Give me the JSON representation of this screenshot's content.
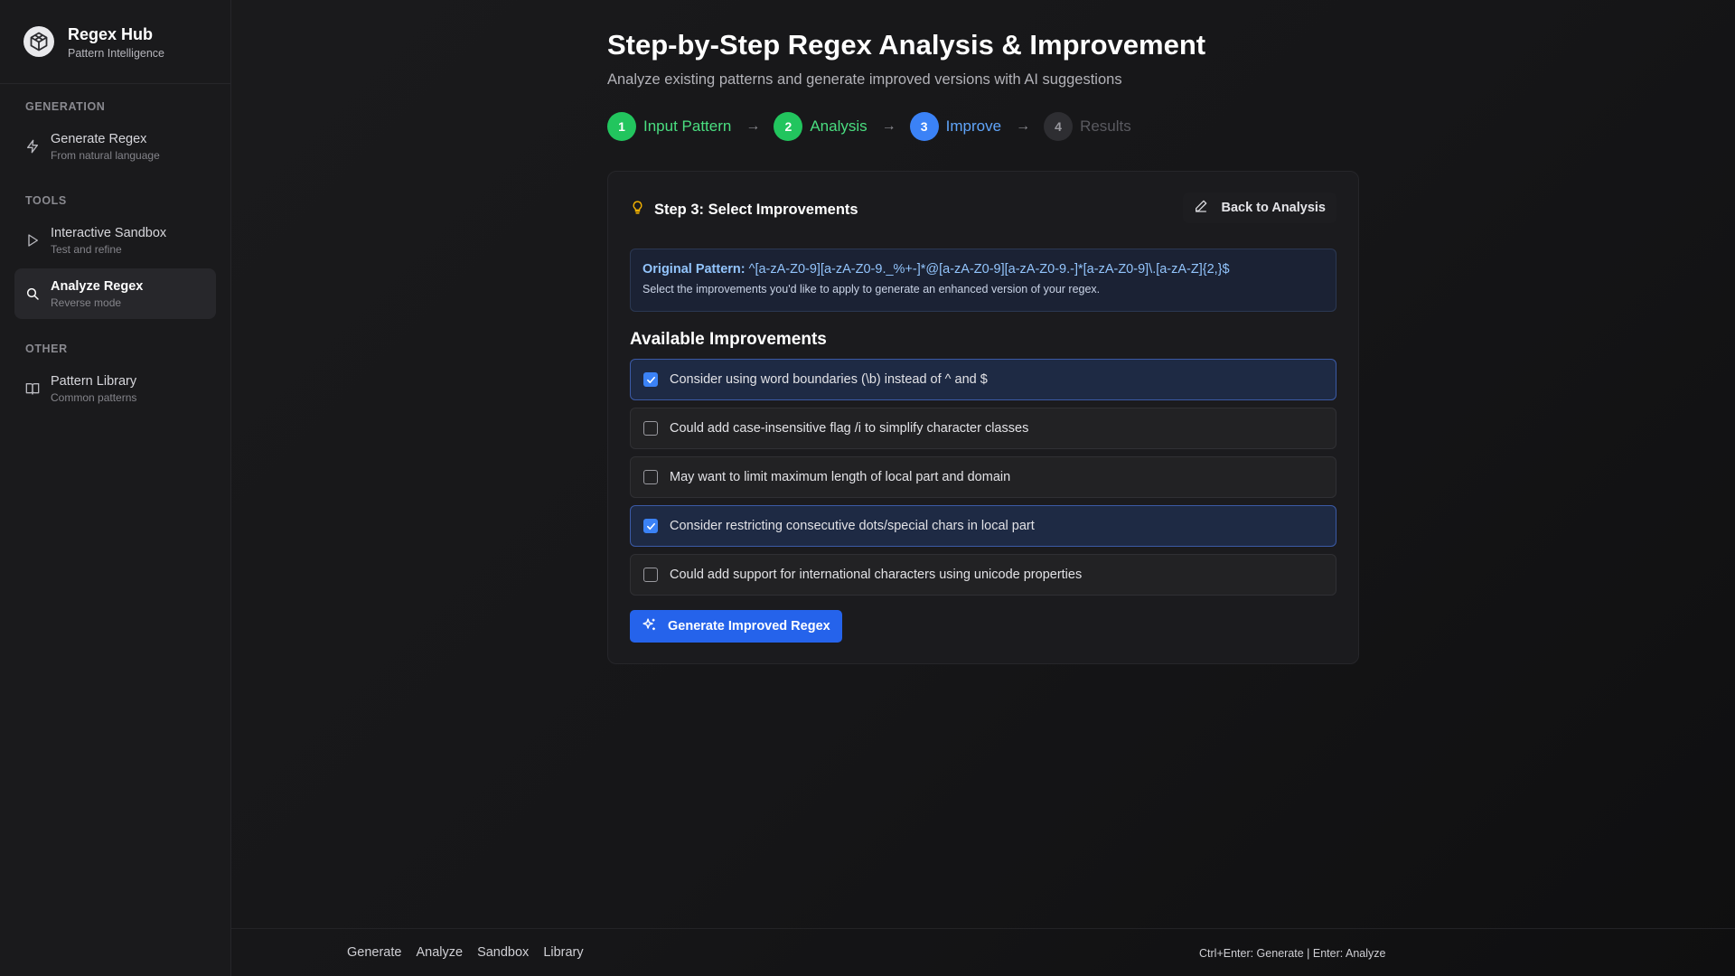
{
  "brand": {
    "title": "Regex Hub",
    "subtitle": "Pattern Intelligence"
  },
  "sidebar": {
    "sections": [
      {
        "label": "GENERATION",
        "items": [
          {
            "title": "Generate Regex",
            "subtitle": "From natural language",
            "icon": "lightning-icon",
            "active": false
          }
        ]
      },
      {
        "label": "TOOLS",
        "items": [
          {
            "title": "Interactive Sandbox",
            "subtitle": "Test and refine",
            "icon": "play-icon",
            "active": false
          },
          {
            "title": "Analyze Regex",
            "subtitle": "Reverse mode",
            "icon": "search-icon",
            "active": true
          }
        ]
      },
      {
        "label": "OTHER",
        "items": [
          {
            "title": "Pattern Library",
            "subtitle": "Common patterns",
            "icon": "book-icon",
            "active": false
          }
        ]
      }
    ]
  },
  "header": {
    "title": "Step-by-Step Regex Analysis & Improvement",
    "subtitle": "Analyze existing patterns and generate improved versions with AI suggestions"
  },
  "steps": [
    {
      "number": "1",
      "label": "Input Pattern",
      "state": "done"
    },
    {
      "number": "2",
      "label": "Analysis",
      "state": "done"
    },
    {
      "number": "3",
      "label": "Improve",
      "state": "current"
    },
    {
      "number": "4",
      "label": "Results",
      "state": "pending"
    }
  ],
  "card": {
    "title": "Step 3: Select Improvements",
    "back_label": "Back to Analysis",
    "pattern_label": "Original Pattern:",
    "pattern_value": "^[a-zA-Z0-9][a-zA-Z0-9._%+-]*@[a-zA-Z0-9][a-zA-Z0-9.-]*[a-zA-Z0-9]\\.[a-zA-Z]{2,}$",
    "pattern_hint": "Select the improvements you'd like to apply to generate an enhanced version of your regex.",
    "available_title": "Available Improvements",
    "improvements": [
      {
        "label": "Consider using word boundaries (\\b) instead of ^ and $",
        "checked": true
      },
      {
        "label": "Could add case-insensitive flag /i to simplify character classes",
        "checked": false
      },
      {
        "label": "May want to limit maximum length of local part and domain",
        "checked": false
      },
      {
        "label": "Consider restricting consecutive dots/special chars in local part",
        "checked": true
      },
      {
        "label": "Could add support for international characters using unicode properties",
        "checked": false
      }
    ],
    "generate_label": "Generate Improved Regex"
  },
  "footer": {
    "links": [
      "Generate",
      "Analyze",
      "Sandbox",
      "Library"
    ],
    "hint": "Ctrl+Enter: Generate | Enter: Analyze"
  },
  "colors": {
    "accent": "#3b82f6",
    "success": "#22c55e",
    "button": "#2563eb"
  }
}
